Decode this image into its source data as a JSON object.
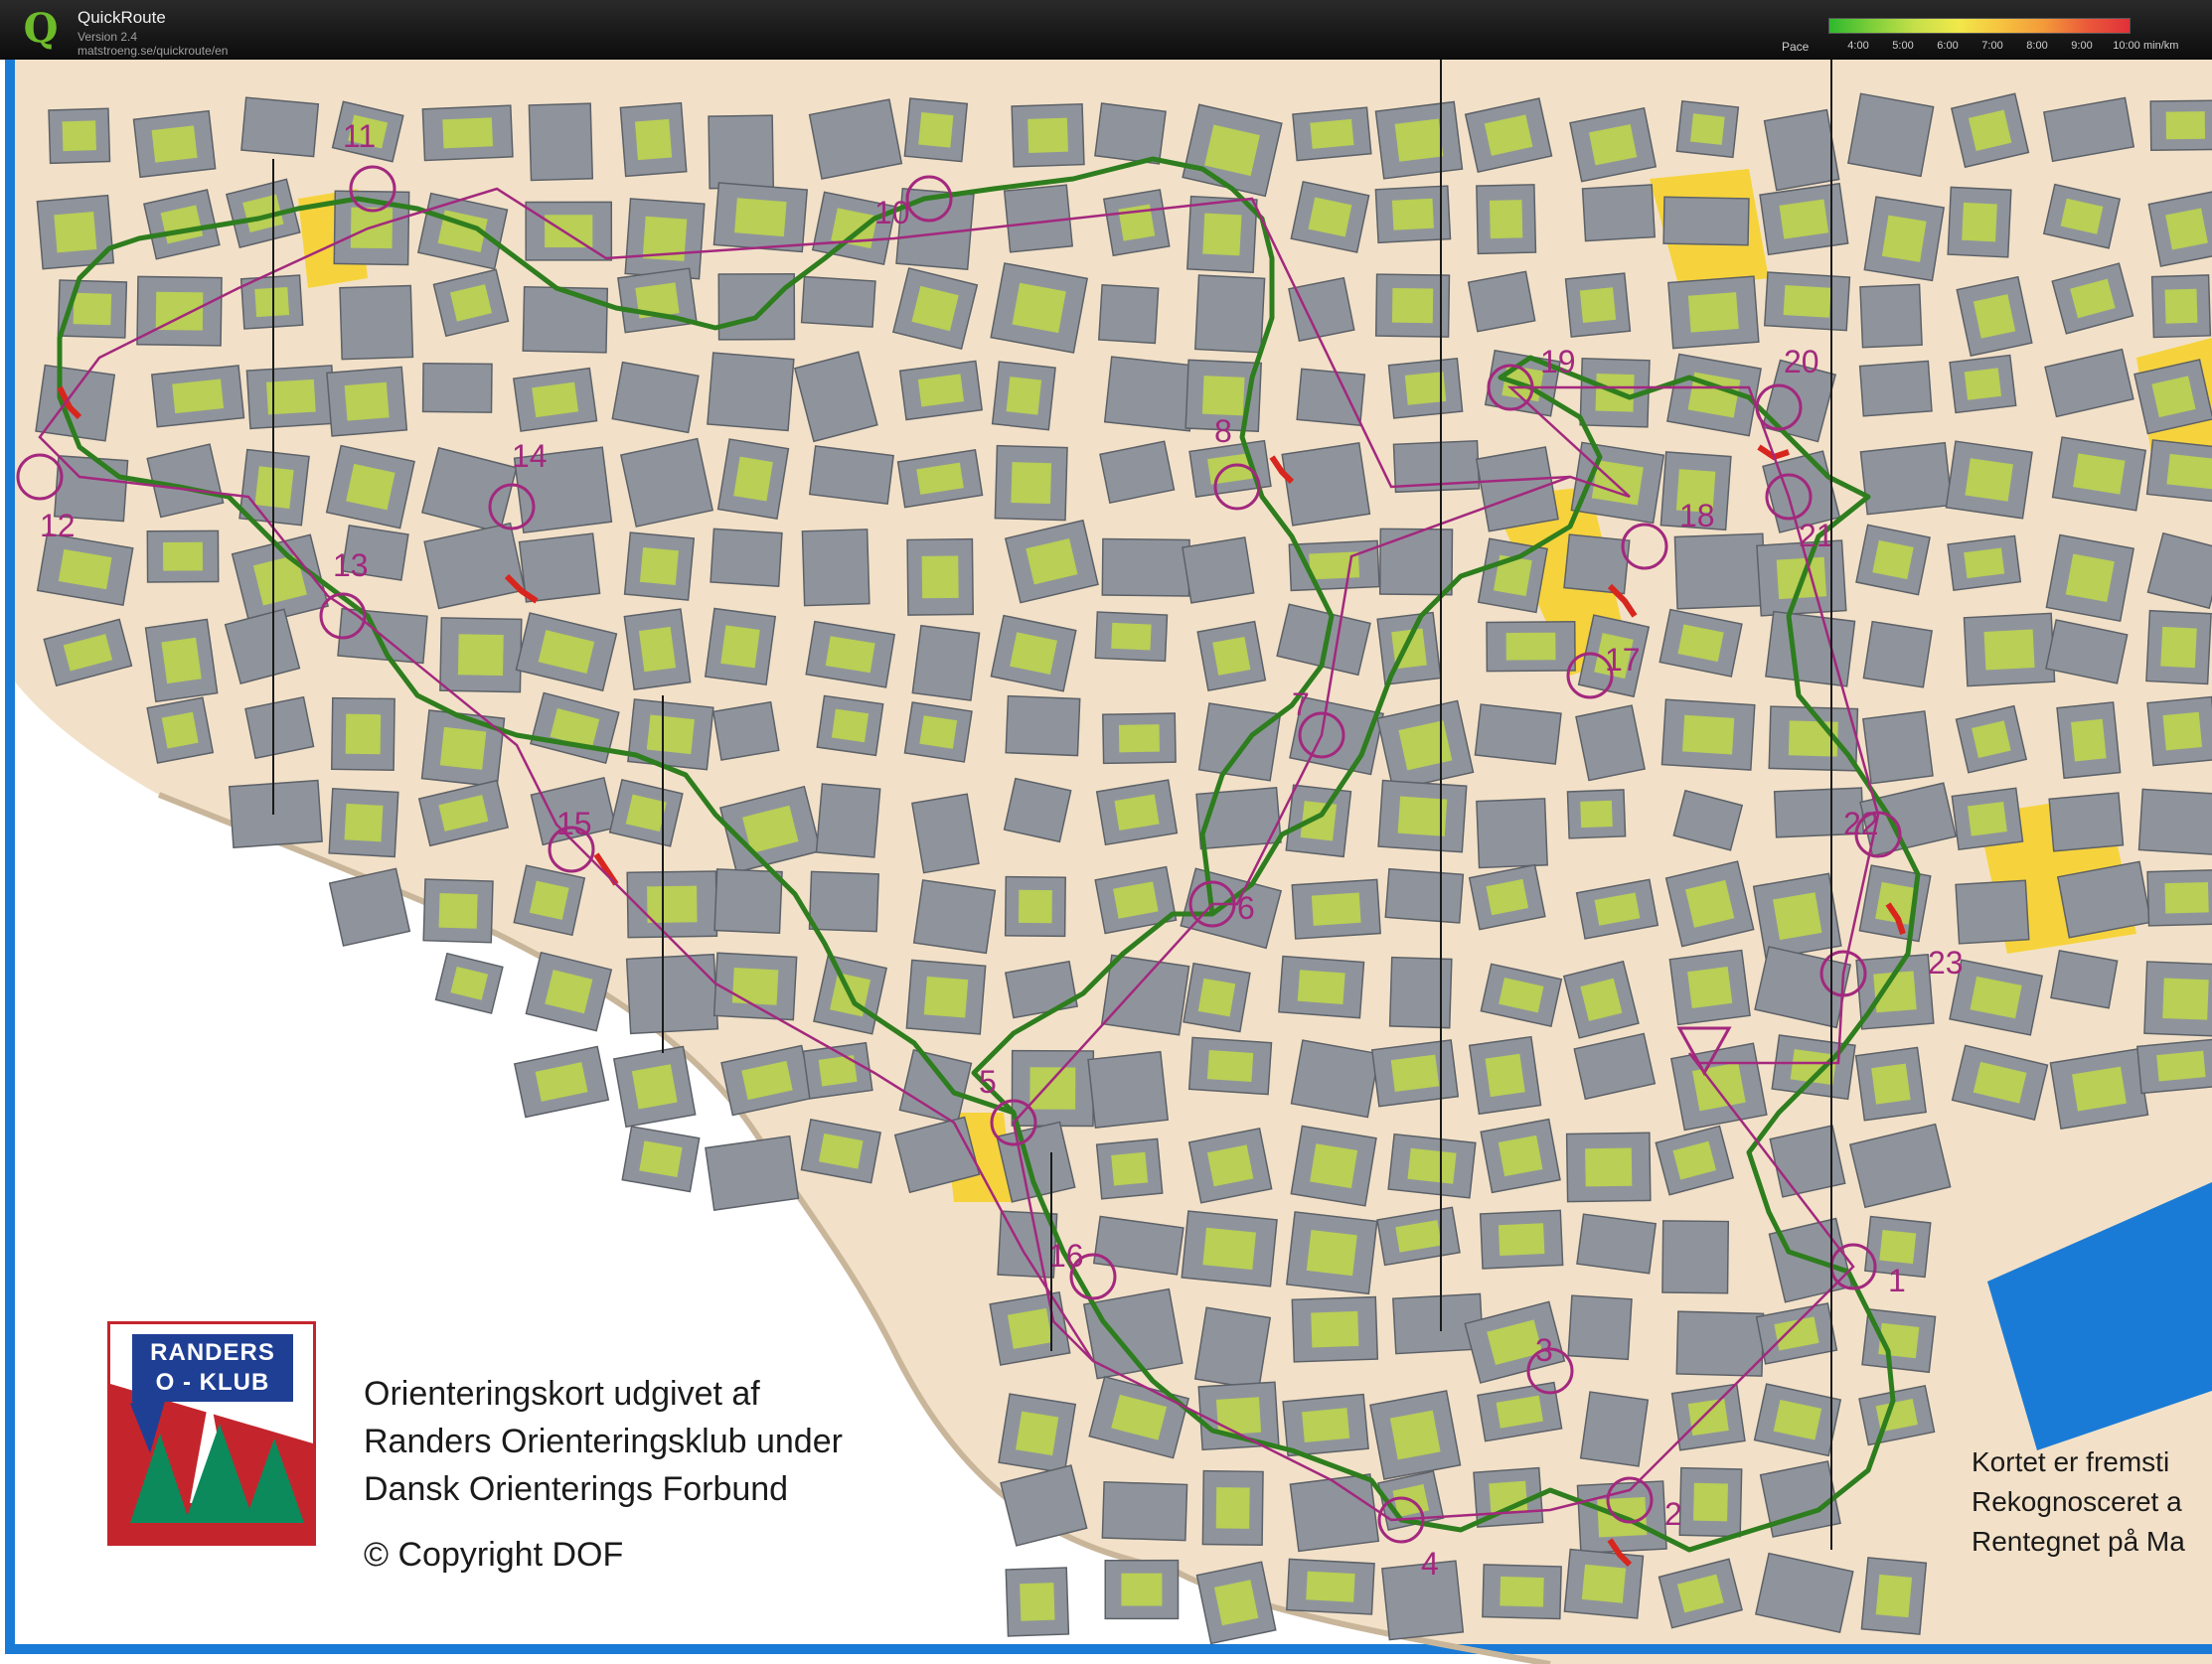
{
  "app": {
    "title": "QuickRoute",
    "version": "Version 2.4",
    "url": "matstroeng.se/quickroute/en",
    "logo_letter": "Q"
  },
  "pace": {
    "label": "Pace",
    "ticks": [
      "4:00",
      "5:00",
      "6:00",
      "7:00",
      "8:00",
      "9:00",
      "10:00"
    ],
    "unit": "min/km"
  },
  "colors": {
    "route_fast": "#2e7d1e",
    "route_slow": "#d8261f",
    "course": "#a3287e",
    "building": "#8f949c",
    "green_area": "#b9cf55",
    "paved": "#f2e1c8",
    "open_yellow": "#f6d33c",
    "water": "#1a7bd6"
  },
  "map": {
    "controls": [
      {
        "label": "1"
      },
      {
        "label": "2"
      },
      {
        "label": "3"
      },
      {
        "label": "4"
      },
      {
        "label": "5"
      },
      {
        "label": "6"
      },
      {
        "label": "7"
      },
      {
        "label": "8"
      },
      {
        "label": "10"
      },
      {
        "label": "11"
      },
      {
        "label": "12"
      },
      {
        "label": "13"
      },
      {
        "label": "14"
      },
      {
        "label": "15"
      },
      {
        "label": "16"
      },
      {
        "label": "17"
      },
      {
        "label": "18"
      },
      {
        "label": "19"
      },
      {
        "label": "20"
      },
      {
        "label": "21"
      },
      {
        "label": "22"
      },
      {
        "label": "23"
      }
    ]
  },
  "club_logo": {
    "line1": "RANDERS",
    "line2": "O - KLUB"
  },
  "imprint": {
    "line1": "Orienteringskort udgivet af",
    "line2": "Randers Orienteringsklub under",
    "line3": "Dansk Orienterings Forbund",
    "copyright": "© Copyright DOF"
  },
  "side_note": {
    "line1": "Kortet er fremsti",
    "line2": "Rekognosceret a",
    "line3": "Rentegnet på Ma"
  }
}
